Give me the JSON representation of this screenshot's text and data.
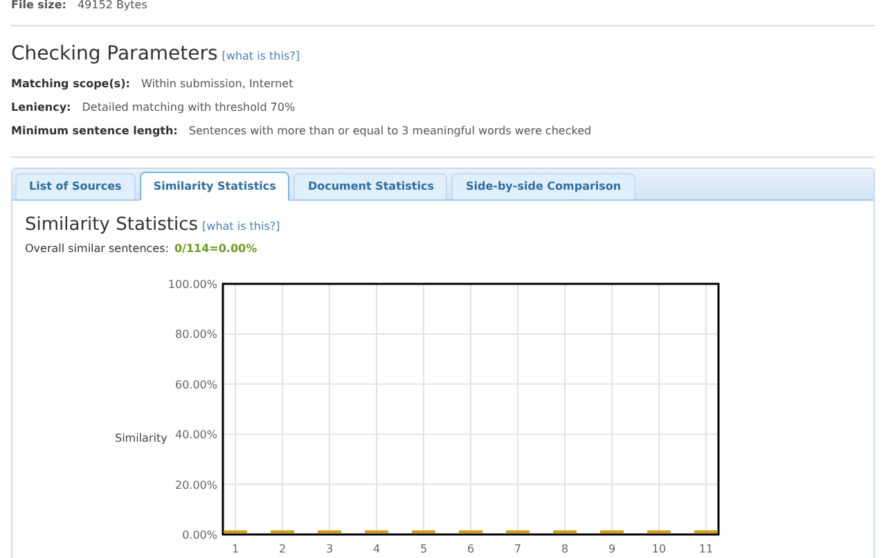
{
  "file_info": {
    "label": "File size:",
    "value": "49152 Bytes"
  },
  "checking_parameters": {
    "title": "Checking Parameters",
    "help_link": "[what is this?]",
    "rows": [
      {
        "label": "Matching scope(s):",
        "value": "Within submission, Internet"
      },
      {
        "label": "Leniency:",
        "value": "Detailed matching with threshold 70%"
      },
      {
        "label": "Minimum sentence length:",
        "value": "Sentences with more than or equal to 3 meaningful words were checked"
      }
    ]
  },
  "tabs": [
    {
      "label": "List of Sources",
      "selected": false
    },
    {
      "label": "Similarity Statistics",
      "selected": true
    },
    {
      "label": "Document Statistics",
      "selected": false
    },
    {
      "label": "Side-by-side Comparison",
      "selected": false
    }
  ],
  "similarity_statistics": {
    "title": "Similarity Statistics",
    "help_link": "[what is this?]",
    "summary_label": "Overall similar sentences:",
    "summary_value": "0/114=0.00%",
    "chart_data": {
      "type": "bar",
      "ylabel": "Similarity",
      "categories": [
        "1",
        "2",
        "3",
        "4",
        "5",
        "6",
        "7",
        "8",
        "9",
        "10",
        "11"
      ],
      "series": [
        {
          "color": "#d4a017",
          "values": [
            0,
            0,
            0,
            0,
            0,
            0,
            0,
            0,
            0,
            0,
            0
          ]
        }
      ],
      "grid": true,
      "ylim": [
        0,
        100
      ],
      "yticks": [
        {
          "value": 0,
          "label": "0.00%"
        },
        {
          "value": 20,
          "label": "20.00%"
        },
        {
          "value": 40,
          "label": "40.00%"
        },
        {
          "value": 60,
          "label": "60.00%"
        },
        {
          "value": 80,
          "label": "80.00%"
        },
        {
          "value": 100,
          "label": "100.00%"
        }
      ]
    }
  }
}
